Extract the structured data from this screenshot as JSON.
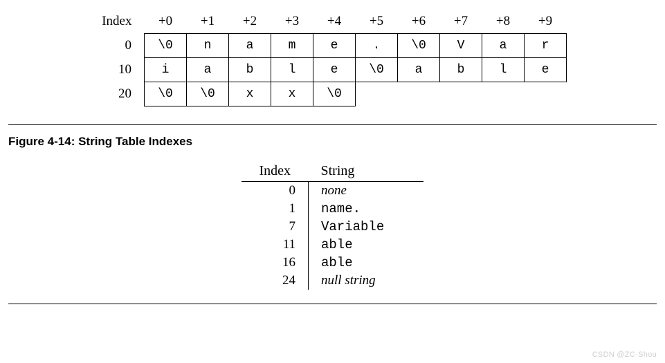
{
  "byte_table": {
    "col_offsets": [
      "+0",
      "+1",
      "+2",
      "+3",
      "+4",
      "+5",
      "+6",
      "+7",
      "+8",
      "+9"
    ],
    "row_index_header": "Index",
    "rows": [
      {
        "index": "0",
        "cells": [
          "\\0",
          "n",
          "a",
          "m",
          "e",
          ".",
          "\\0",
          "V",
          "a",
          "r"
        ]
      },
      {
        "index": "10",
        "cells": [
          "i",
          "a",
          "b",
          "l",
          "e",
          "\\0",
          "a",
          "b",
          "l",
          "e"
        ]
      },
      {
        "index": "20",
        "cells": [
          "\\0",
          "\\0",
          "x",
          "x",
          "\\0"
        ]
      }
    ]
  },
  "figure_title": "Figure 4-14:  String Table Indexes",
  "index_table": {
    "headers": {
      "index": "Index",
      "string": "String"
    },
    "rows": [
      {
        "index": "0",
        "string": "none",
        "style": "italic"
      },
      {
        "index": "1",
        "string": "name.",
        "style": "mono"
      },
      {
        "index": "7",
        "string": "Variable",
        "style": "mono"
      },
      {
        "index": "11",
        "string": "able",
        "style": "mono"
      },
      {
        "index": "16",
        "string": "able",
        "style": "mono"
      },
      {
        "index": "24",
        "string": "null string",
        "style": "italic"
      }
    ]
  },
  "watermark": "CSDN @ZC·Shou"
}
